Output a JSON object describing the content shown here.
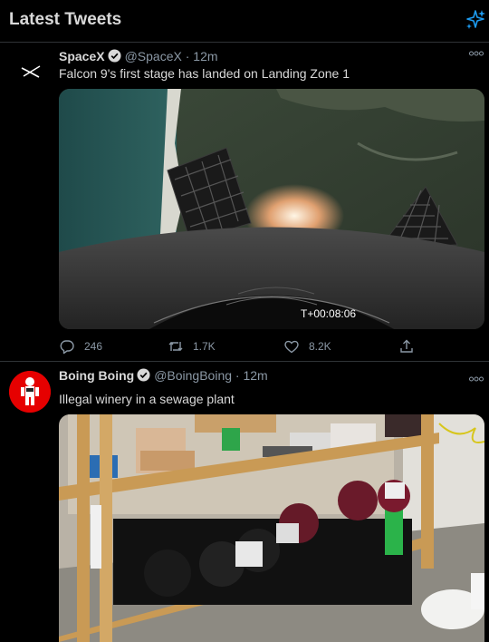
{
  "header": {
    "title": "Latest Tweets",
    "sparkle_icon": "sparkle-icon"
  },
  "tweets": [
    {
      "name": "SpaceX",
      "handle": "@SpaceX",
      "time": "12m",
      "separator": "·",
      "text": "Falcon 9's first stage has landed on Landing Zone 1",
      "media_overlay": "T+00:08:06",
      "replies": "246",
      "retweets": "1.7K",
      "likes": "8.2K"
    },
    {
      "name": "Boing Boing",
      "handle": "@BoingBoing",
      "time": "12m",
      "separator": "·",
      "text": "Illegal winery in a sewage plant"
    }
  ],
  "colors": {
    "background": "#000000",
    "muted": "#8b98a5",
    "accent": "#1d9bf0",
    "divider": "#2f3336"
  }
}
